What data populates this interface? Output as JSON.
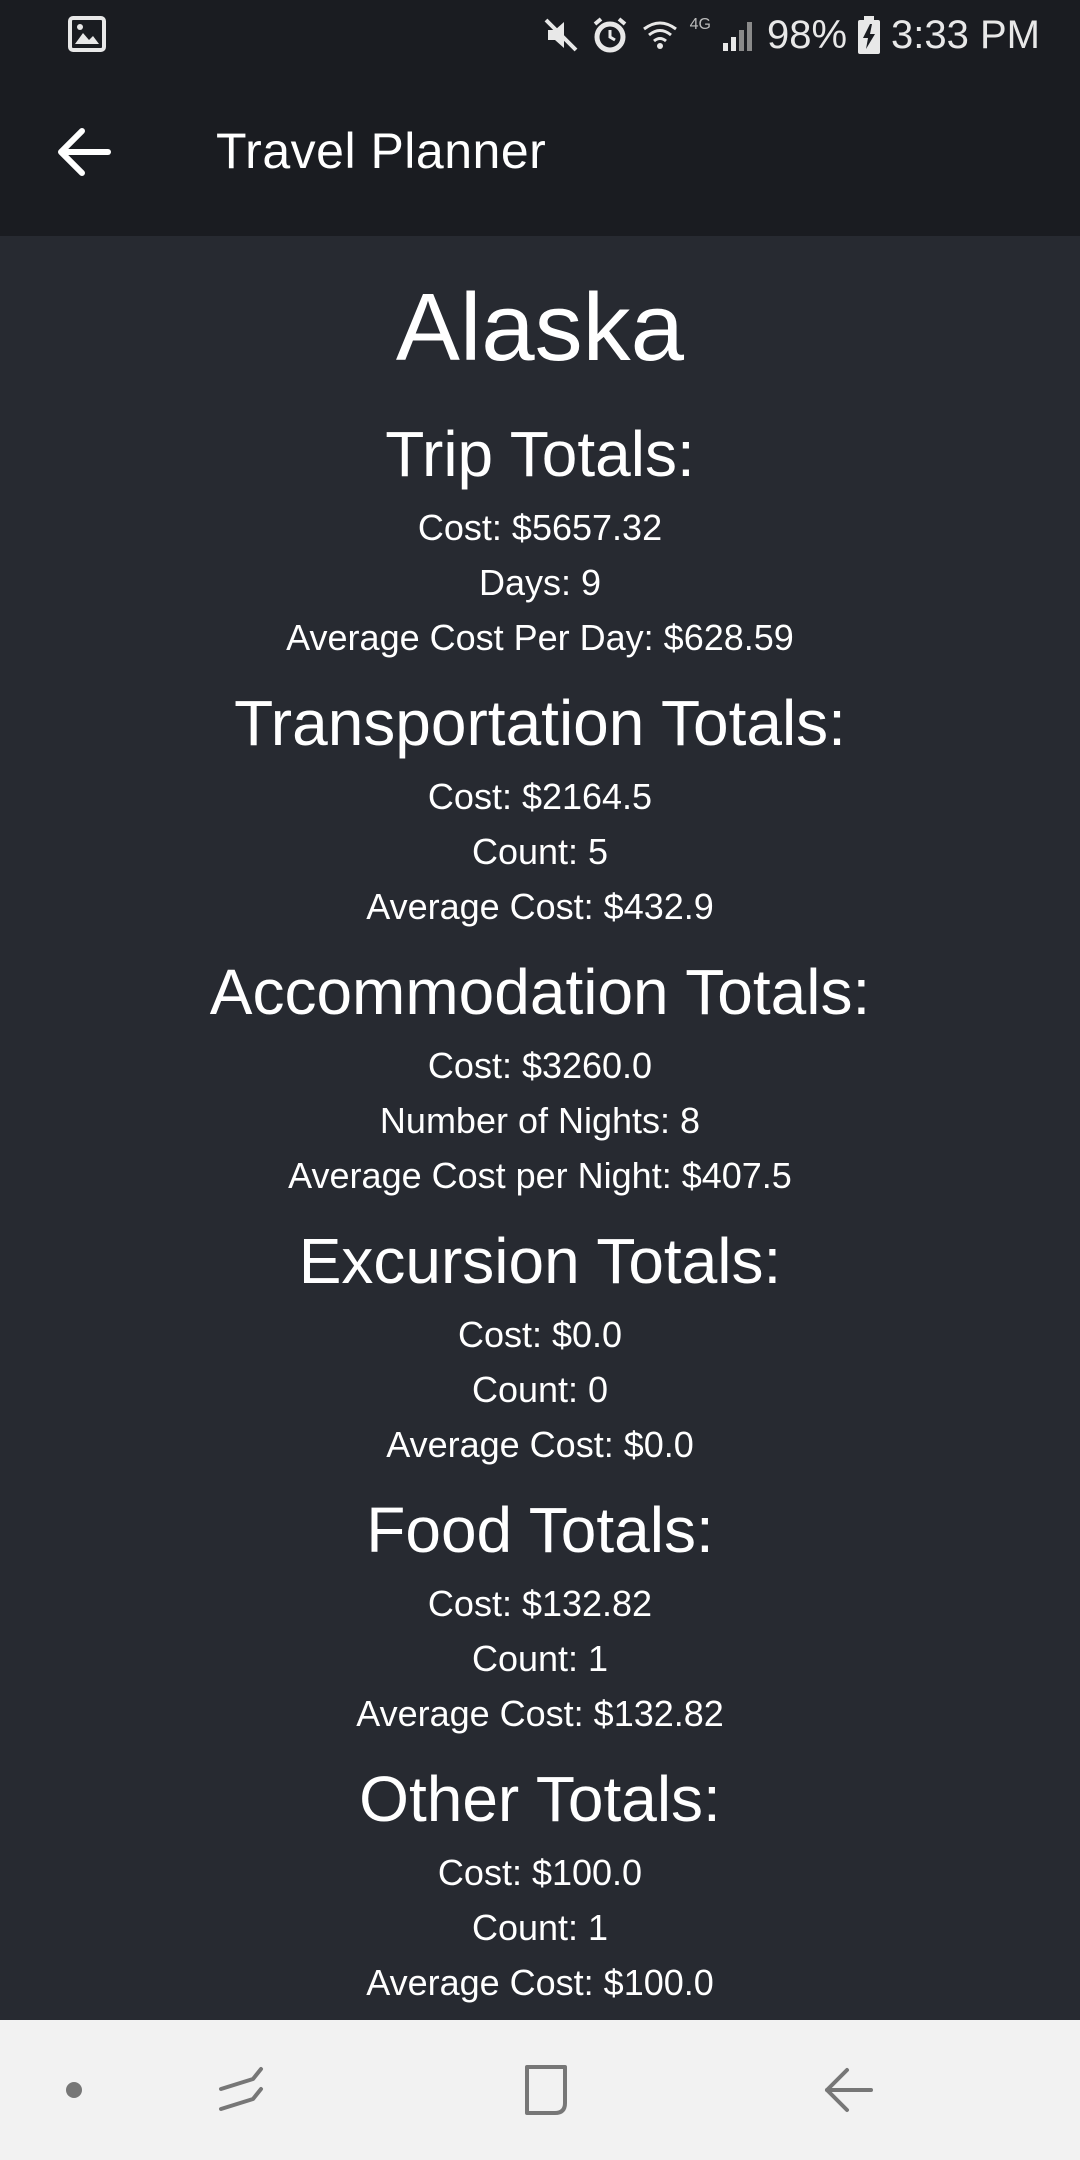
{
  "status_bar": {
    "battery": "98%",
    "time": "3:33 PM",
    "network_label": "4G",
    "icons": [
      "image-icon",
      "mute-icon",
      "alarm-icon",
      "wifi-icon",
      "signal-icon",
      "battery-charging-icon"
    ]
  },
  "app_bar": {
    "title": "Travel Planner",
    "back_icon": "arrow-back-icon"
  },
  "trip": {
    "name": "Alaska",
    "sections": [
      {
        "title": "Trip Totals:",
        "lines": [
          "Cost: $5657.32",
          "Days: 9",
          "Average Cost Per Day: $628.59"
        ]
      },
      {
        "title": "Transportation Totals:",
        "lines": [
          "Cost: $2164.5",
          "Count: 5",
          "Average Cost: $432.9"
        ]
      },
      {
        "title": "Accommodation Totals:",
        "lines": [
          "Cost: $3260.0",
          "Number of Nights: 8",
          "Average Cost per Night: $407.5"
        ]
      },
      {
        "title": "Excursion Totals:",
        "lines": [
          "Cost: $0.0",
          "Count: 0",
          "Average Cost: $0.0"
        ]
      },
      {
        "title": "Food Totals:",
        "lines": [
          "Cost: $132.82",
          "Count: 1",
          "Average Cost: $132.82"
        ]
      },
      {
        "title": "Other Totals:",
        "lines": [
          "Cost: $100.0",
          "Count: 1",
          "Average Cost: $100.0"
        ]
      }
    ]
  },
  "nav_bar": {
    "icons": [
      "dot-icon",
      "recent-apps-icon",
      "home-icon",
      "back-icon"
    ]
  },
  "colors": {
    "background": "#272a31",
    "app_bar": "#1a1c21",
    "text": "#ffffff",
    "nav_bar": "#f2f2f2"
  }
}
